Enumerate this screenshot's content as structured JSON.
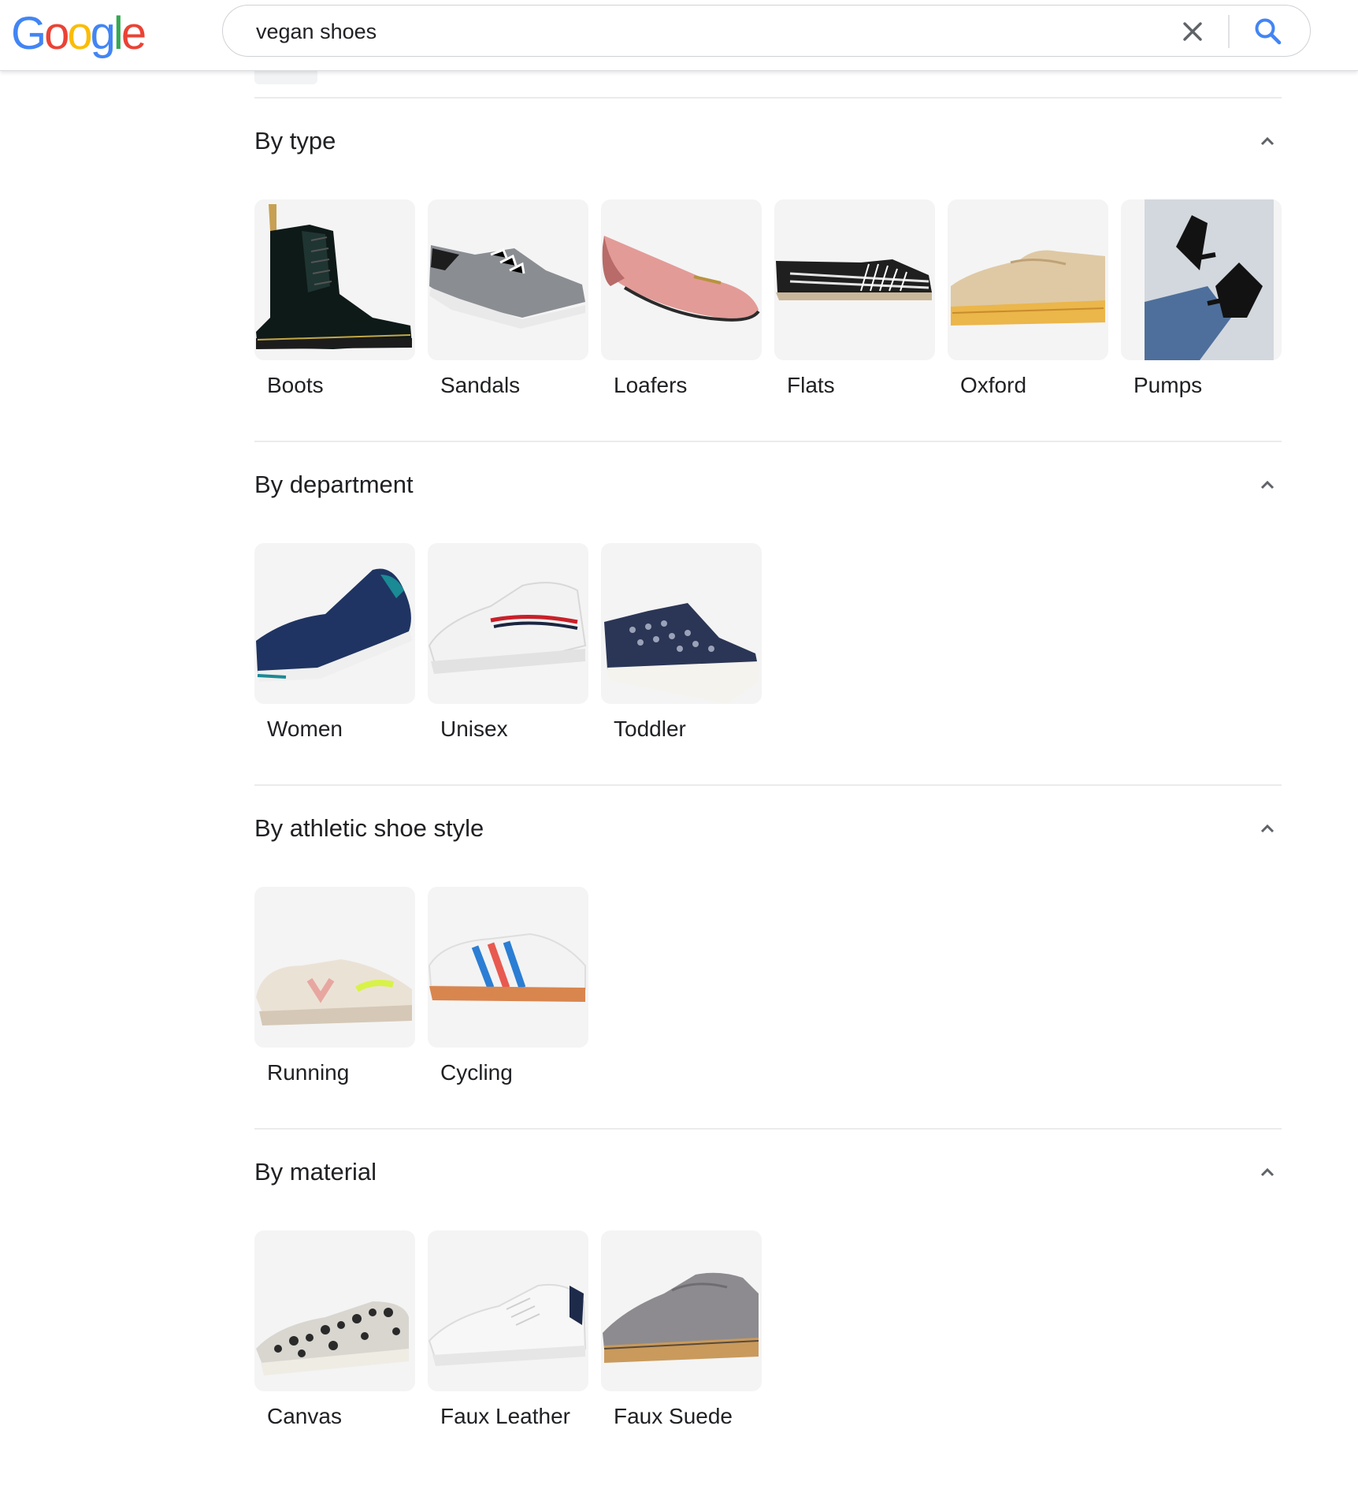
{
  "logo": {
    "letters": [
      "G",
      "o",
      "o",
      "g",
      "l",
      "e"
    ]
  },
  "search": {
    "query": "vegan shoes",
    "placeholder": ""
  },
  "sections": [
    {
      "title": "By type",
      "items": [
        {
          "label": "Boots",
          "icon": "boot-image"
        },
        {
          "label": "Sandals",
          "icon": "sandal-image"
        },
        {
          "label": "Loafers",
          "icon": "loafer-image"
        },
        {
          "label": "Flats",
          "icon": "flat-image"
        },
        {
          "label": "Oxford",
          "icon": "oxford-image"
        },
        {
          "label": "Pumps",
          "icon": "pump-image"
        }
      ]
    },
    {
      "title": "By department",
      "items": [
        {
          "label": "Women",
          "icon": "women-sneaker-image"
        },
        {
          "label": "Unisex",
          "icon": "unisex-sneaker-image"
        },
        {
          "label": "Toddler",
          "icon": "toddler-shoe-image"
        }
      ]
    },
    {
      "title": "By athletic shoe style",
      "items": [
        {
          "label": "Running",
          "icon": "running-shoe-image"
        },
        {
          "label": "Cycling",
          "icon": "cycling-shoe-image"
        }
      ]
    },
    {
      "title": "By material",
      "items": [
        {
          "label": "Canvas",
          "icon": "canvas-shoe-image"
        },
        {
          "label": "Faux Leather",
          "icon": "faux-leather-shoe-image"
        },
        {
          "label": "Faux Suede",
          "icon": "faux-suede-shoe-image"
        }
      ]
    }
  ],
  "colors": {
    "google_blue": "#4285f4",
    "google_red": "#ea4335",
    "google_yellow": "#fbbc05",
    "google_green": "#34a853",
    "search_icon": "#4285f4",
    "tile_bg": "#f4f4f4",
    "divider": "#ebebeb"
  }
}
